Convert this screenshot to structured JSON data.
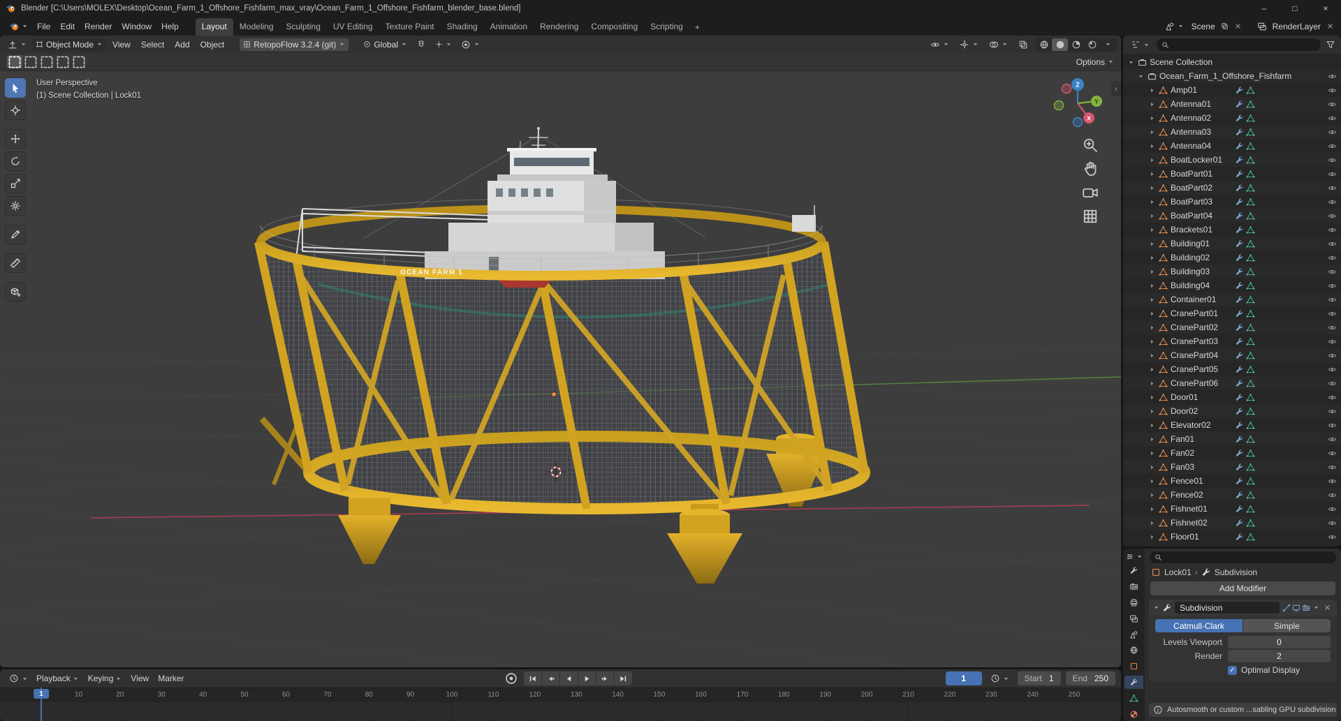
{
  "colors": {
    "accent": "#4772b3",
    "blender-orange": "#e87d0d",
    "axis-x": "#d5566d",
    "axis-y": "#86b33c",
    "axis-z": "#3d82c4",
    "model-yellow": "#d9a826"
  },
  "window": {
    "title": "Blender [C:\\Users\\MOLEX\\Desktop\\Ocean_Farm_1_Offshore_Fishfarm_max_vray\\Ocean_Farm_1_Offshore_Fishfarm_blender_base.blend]",
    "controls": [
      {
        "name": "minimize",
        "glyph": "–"
      },
      {
        "name": "maximize",
        "glyph": "□"
      },
      {
        "name": "close",
        "glyph": "×"
      }
    ]
  },
  "menubar": {
    "menus": [
      "File",
      "Edit",
      "Render",
      "Window",
      "Help"
    ],
    "workspaces": [
      "Layout",
      "Modeling",
      "Sculpting",
      "UV Editing",
      "Texture Paint",
      "Shading",
      "Animation",
      "Rendering",
      "Compositing",
      "Scripting"
    ],
    "active_workspace": "Layout",
    "new_workspace_label": "+",
    "scene_label": "Scene",
    "view_layer_label": "RenderLayer"
  },
  "viewport": {
    "header": {
      "mode": "Object Mode",
      "menus": [
        "View",
        "Select",
        "Add",
        "Object"
      ],
      "addon_button": "RetopoFlow 3.2.4 (git)",
      "orientation": "Global",
      "options_label": "Options"
    },
    "tools": [
      "tweak-select",
      "cursor",
      "move",
      "rotate",
      "scale",
      "transform",
      "annotate",
      "measure",
      "add-cube"
    ],
    "overlay": {
      "view_name": "User Perspective",
      "context": "(1) Scene Collection | Lock01"
    },
    "model_label": "OCEAN FARM 1",
    "gizmo": {
      "x": "X",
      "y": "Y",
      "z": "Z"
    }
  },
  "outliner": {
    "root_label": "Scene Collection",
    "collection_label": "Ocean_Farm_1_Offshore_Fishfarm",
    "objects": [
      "Amp01",
      "Antenna01",
      "Antenna02",
      "Antenna03",
      "Antenna04",
      "BoatLocker01",
      "BoatPart01",
      "BoatPart02",
      "BoatPart03",
      "BoatPart04",
      "Brackets01",
      "Building01",
      "Building02",
      "Building03",
      "Building04",
      "Container01",
      "CranePart01",
      "CranePart02",
      "CranePart03",
      "CranePart04",
      "CranePart05",
      "CranePart06",
      "Door01",
      "Door02",
      "Elevator02",
      "Fan01",
      "Fan02",
      "Fan03",
      "Fence01",
      "Fence02",
      "Fishnet01",
      "Fishnet02",
      "Floor01"
    ]
  },
  "properties": {
    "tabs": [
      "tool",
      "render",
      "output",
      "view-layer",
      "scene",
      "world",
      "object",
      "modifiers",
      "data",
      "material"
    ],
    "active_tab": "modifiers",
    "breadcrumb_object": "Lock01",
    "breadcrumb_item": "Subdivision",
    "add_modifier_label": "Add Modifier",
    "modifier": {
      "name": "Subdivision",
      "algorithms": [
        "Catmull-Clark",
        "Simple"
      ],
      "active_algorithm": "Catmull-Clark",
      "rows": [
        {
          "label": "Levels Viewport",
          "value": "0"
        },
        {
          "label": "Render",
          "value": "2"
        }
      ],
      "optimal_display_label": "Optimal Display",
      "optimal_display_checked": true
    },
    "warning_text": "Autosmooth or custom ...sabling GPU subdivision"
  },
  "timeline": {
    "menus": [
      {
        "label": "Playback",
        "caret": true
      },
      {
        "label": "Keying",
        "caret": true
      },
      {
        "label": "View",
        "caret": false
      },
      {
        "label": "Marker",
        "caret": false
      }
    ],
    "current_frame": "1",
    "start_label": "Start",
    "start_value": "1",
    "end_label": "End",
    "end_value": "250",
    "ticks": [
      1,
      10,
      20,
      30,
      40,
      50,
      60,
      70,
      80,
      90,
      100,
      110,
      120,
      130,
      140,
      150,
      160,
      170,
      180,
      190,
      200,
      210,
      220,
      230,
      240,
      250
    ]
  }
}
